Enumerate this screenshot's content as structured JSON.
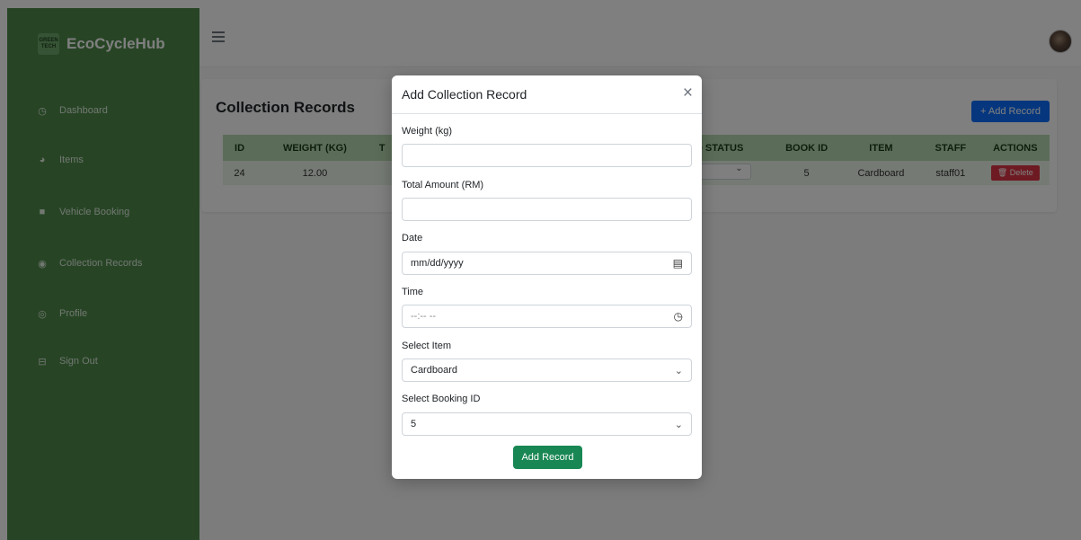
{
  "brand": {
    "name": "EcoCycleHub",
    "logo_text": "GREEN TECH"
  },
  "sidebar": {
    "items": [
      {
        "label": "Dashboard",
        "icon": "clock-icon"
      },
      {
        "label": "Items",
        "icon": "pie-icon"
      },
      {
        "label": "Vehicle Booking",
        "icon": "truck-icon"
      },
      {
        "label": "Collection Records",
        "icon": "target-icon"
      },
      {
        "label": "Profile",
        "icon": "user-circle-icon"
      },
      {
        "label": "Sign Out",
        "icon": "sign-out-icon"
      }
    ]
  },
  "page": {
    "title": "Collection Records",
    "add_button": "+ Add Record"
  },
  "table": {
    "headers": [
      "ID",
      "WEIGHT (KG)",
      "T",
      "D STATUS",
      "BOOK ID",
      "ITEM",
      "STAFF",
      "ACTIONS"
    ],
    "rows": [
      {
        "id": "24",
        "weight": "12.00",
        "book_id": "5",
        "item": "Cardboard",
        "staff": "staff01",
        "delete_label": "🗑 Delete"
      }
    ]
  },
  "modal": {
    "title": "Add Collection Record",
    "close": "×",
    "weight_label": "Weight (kg)",
    "amount_label": "Total Amount (RM)",
    "date_label": "Date",
    "date_placeholder": "mm/dd/yyyy",
    "time_label": "Time",
    "time_placeholder": "--:-- --",
    "item_label": "Select Item",
    "item_value": "Cardboard",
    "booking_label": "Select Booking ID",
    "booking_value": "5",
    "submit": "Add Record"
  },
  "colors": {
    "sidebar": "#4e8a4a",
    "primary": "#0d6efd",
    "success": "#198754",
    "danger": "#dc3545",
    "table_header": "#b7dbb1"
  }
}
